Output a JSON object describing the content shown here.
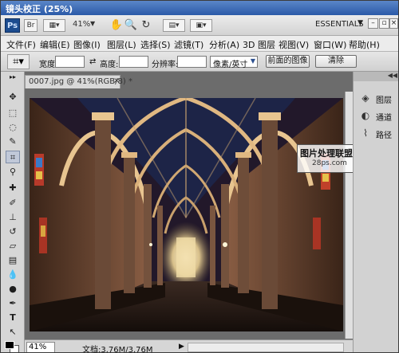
{
  "window": {
    "title": "镜头校正 (25%)"
  },
  "appbar": {
    "logo": "Ps",
    "bridge_label": "Br",
    "zoom": "41%",
    "workspace": "ESSENTIALS",
    "workspace_arrow": "▼",
    "controls": {
      "minimize": "–",
      "restore": "▫",
      "close": "×"
    }
  },
  "menu": [
    "文件(F)",
    "编辑(E)",
    "图像(I)",
    "图层(L)",
    "选择(S)",
    "滤镜(T)",
    "分析(A)",
    "3D 图层",
    "视图(V)",
    "窗口(W)",
    "帮助(H)"
  ],
  "options": {
    "width_label": "宽度:",
    "swap_icon": "⇄",
    "height_label": "高度:",
    "resolution_label": "分辨率:",
    "unit_select": "像素/英寸",
    "front_image_button": "前面的图像",
    "clear_button": "清除"
  },
  "document": {
    "tab_title": "0007.jpg @ 41%(RGB/8) *",
    "tab_close": "×",
    "status_zoom": "41%",
    "status_doc": "文档:3.76M/3.76M",
    "status_arrow": "▶"
  },
  "watermark": {
    "line1": "图片处理联盟网",
    "line2": "28ps.com"
  },
  "panels": [
    {
      "label": "图层",
      "icon": "layers-icon"
    },
    {
      "label": "通道",
      "icon": "channels-icon"
    },
    {
      "label": "路径",
      "icon": "paths-icon"
    }
  ],
  "panel_header": "◀◀",
  "colors": {
    "titlebar": "#2b5aa8",
    "ps_logo": "#1c4c8f",
    "vault_sky": "#1d2447",
    "pillar": "#6a4a37",
    "arch_light": "#e8c590"
  }
}
